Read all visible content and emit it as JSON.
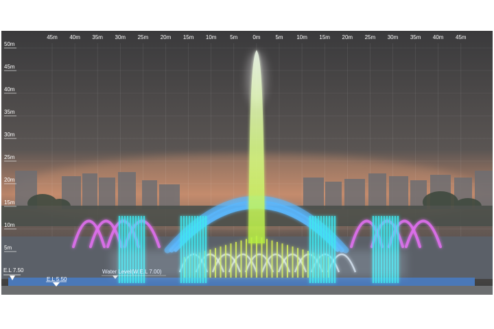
{
  "x_axis": {
    "labels": [
      "45m",
      "40m",
      "35m",
      "30m",
      "25m",
      "20m",
      "15m",
      "10m",
      "5m",
      "0m",
      "5m",
      "10m",
      "15m",
      "20m",
      "25m",
      "30m",
      "35m",
      "40m",
      "45m"
    ]
  },
  "y_axis": {
    "labels": [
      "50m",
      "45m",
      "40m",
      "35m",
      "30m",
      "25m",
      "20m",
      "15m",
      "10m",
      "5m"
    ]
  },
  "elevations": [
    {
      "label": "E.L 7.50"
    },
    {
      "label": "E.L 5.50"
    }
  ],
  "water_level": {
    "label": "Water Level(W.E.L 7.00)"
  },
  "colors": {
    "sky_top": "#3c3c3e",
    "sky_glow": "#c98a6a",
    "pool": "#4a78b8",
    "arch": "#5ab8ff",
    "magenta": "#e070f0",
    "cyan": "#3ee8f0",
    "yellow": "#d8f050",
    "center_jet": "#e8ffb0"
  },
  "icons": [
    "elevation-marker-icon"
  ]
}
